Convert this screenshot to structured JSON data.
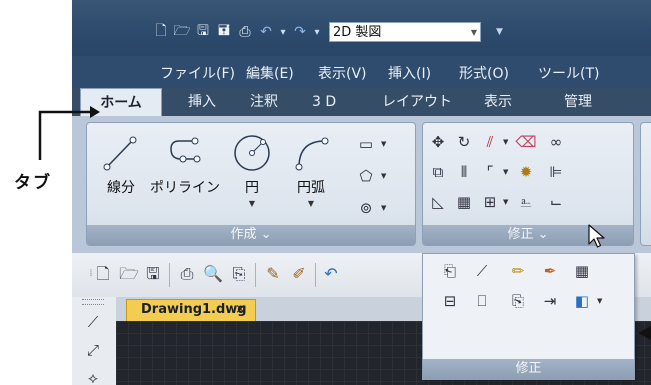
{
  "annotation": {
    "tab_label": "タブ"
  },
  "title_bar": {
    "workspace_value": "2D 製図",
    "quick_access_icons": [
      "new-file-icon",
      "open-folder-icon",
      "save-icon",
      "save-as-icon",
      "print-icon",
      "undo-icon",
      "redo-icon"
    ]
  },
  "menu_bar": {
    "items": [
      "ファイル(F)",
      "編集(E)",
      "表示(V)",
      "挿入(I)",
      "形式(O)",
      "ツール(T)"
    ]
  },
  "ribbon": {
    "tabs": [
      "ホーム",
      "挿入",
      "注釈",
      "3 D",
      "レイアウト",
      "表示",
      "管理"
    ],
    "active_tab": "ホーム",
    "draw_panel": {
      "title": "作成 ⌄",
      "tools": [
        "線分",
        "ポリライン",
        "円",
        "円弧"
      ]
    },
    "modify_panel": {
      "title": "修正 ⌄"
    }
  },
  "document": {
    "tab_name": "Drawing1.dwg",
    "close": "×"
  },
  "flyout": {
    "title": "修正"
  },
  "colors": {
    "active_doc_tab": "#f3cd52",
    "title_bar": "#2c4a6c",
    "canvas": "#22262c"
  }
}
